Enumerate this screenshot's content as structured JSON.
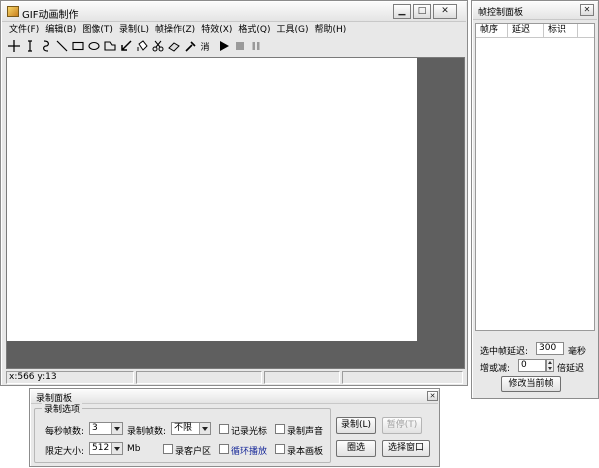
{
  "main_window": {
    "title": "GIF动画制作",
    "menu": [
      "文件(F)",
      "编辑(B)",
      "图像(T)",
      "录制(L)",
      "帧操作(Z)",
      "特效(X)",
      "格式(Q)",
      "工具(G)",
      "帮助(H)"
    ],
    "toolbar": {
      "text_tool_label": "消",
      "icons": [
        "crosshair-icon",
        "text-cursor-icon",
        "curve-icon",
        "line-icon",
        "rectangle-icon",
        "ellipse-icon",
        "polygon-icon",
        "arrow-icon",
        "fill-bucket-icon",
        "scissors-icon",
        "eraser-icon",
        "eyedropper-icon",
        "clear-text",
        "play-icon",
        "stop-icon",
        "pause-icon"
      ]
    },
    "status": {
      "coords": "x:566 y:13"
    }
  },
  "frame_panel": {
    "title": "帧控制面板",
    "columns": [
      "帧序",
      "延迟",
      "标识"
    ],
    "selected_delay_label": "选中帧延迟:",
    "selected_delay_value": "300",
    "selected_delay_unit": "毫秒",
    "scale_label": "增或减:",
    "scale_value": "0",
    "scale_unit": "倍延迟",
    "modify_button": "修改当前帧"
  },
  "record_panel": {
    "title": "录制面板",
    "group_title": "录制选项",
    "fps_label": "每秒帧数:",
    "fps_value": "3",
    "frames_label": "录制帧数:",
    "frames_value": "不限",
    "size_label": "限定大小:",
    "size_value": "512",
    "size_unit": "Mb",
    "checkboxes": {
      "record_cursor": "记录光标",
      "record_sound": "录制声音",
      "client_area": "录客户区",
      "loop_play": "循环播放",
      "record_canvas": "录本画板"
    },
    "record_button": "录制(L)",
    "pause_button": "暂停(T)",
    "select_area_button": "圈选",
    "select_window_button": "选择窗口"
  },
  "colors": {
    "canvas_bg": "#5f5f5f",
    "loop_link": "#1a2b9a"
  }
}
